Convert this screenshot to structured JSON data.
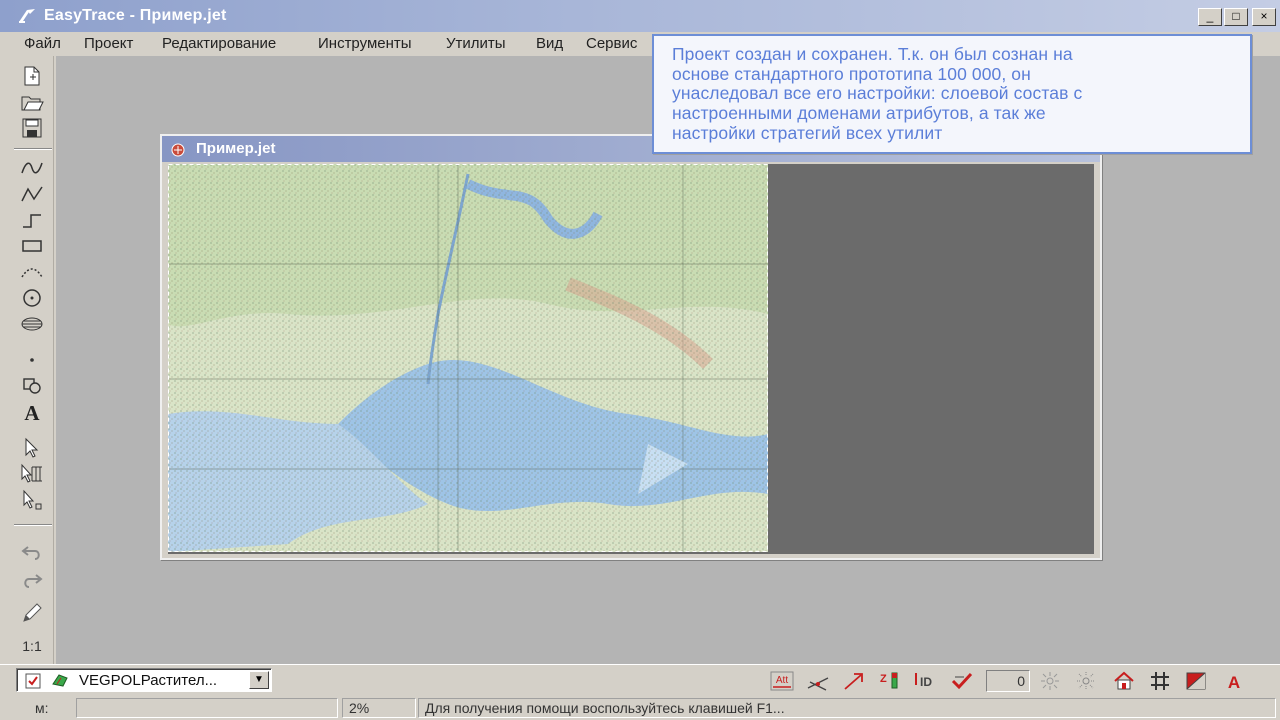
{
  "window": {
    "title": "EasyTrace - Пример.jet",
    "minimize": "_",
    "maximize": "□",
    "close": "×"
  },
  "menu": [
    "Файл",
    "Проект",
    "Редактирование",
    "Инструменты",
    "Утилиты",
    "Вид",
    "Сервис"
  ],
  "left_toolbar": {
    "scale_label": "1:1",
    "icons": [
      "new-project-icon",
      "open-project-icon",
      "save-project-icon",
      "spline-tool-icon",
      "polyline-tool-icon",
      "orthogonal-line-tool-icon",
      "rectangle-tool-icon",
      "arc-tool-icon",
      "circle-tool-icon",
      "hatch-tool-icon",
      "point-tool-icon",
      "symbol-tool-icon",
      "text-tool-icon",
      "select-tool-icon",
      "multi-select-tool-icon",
      "node-select-tool-icon",
      "undo-icon",
      "redo-icon",
      "pencil-icon"
    ]
  },
  "child_window": {
    "title": "Пример.jet"
  },
  "callout": {
    "lines": [
      "Проект создан и сохранен. Т.к. он был сознан на",
      "основе стандартного прототипа 100 000, он",
      "унаследовал все его настройки: слоевой состав с",
      "настроенными доменами атрибутов, а так же",
      "настройки стратегий всех утилит"
    ],
    "border_color": "#6d8ed6",
    "text_color": "#5b7ed8"
  },
  "bottom_toolbar": {
    "layer_combo_value": "VEGPOLРастител...",
    "id_field_value": "0",
    "icons": [
      "attribute-table-icon",
      "snap-lines-icon",
      "arrow-link-icon",
      "z-order-icon",
      "id-icon",
      "check-icon",
      "sun-icon",
      "sun-outline-icon",
      "home-vertex-icon",
      "grid-hash-icon",
      "fill-toggle-icon",
      "text-style-icon"
    ],
    "icon_labels": {
      "att": "Att",
      "z": "Z",
      "id": "ID",
      "text": "A"
    }
  },
  "status_bar": {
    "mode_label": "м:",
    "progress_value": "",
    "zoom": "2%",
    "help_text": "Для получения помощи воспользуйтесь клавишей F1..."
  }
}
